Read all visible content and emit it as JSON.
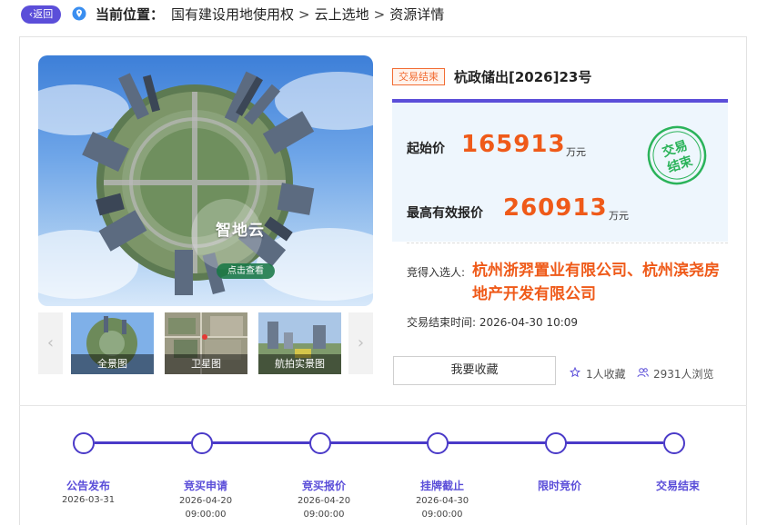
{
  "breadcrumb": {
    "back_label": "返回",
    "location_label": "当前位置：",
    "items": [
      "国有建设用地使用权",
      "云上选地",
      "资源详情"
    ],
    "separator": ">"
  },
  "gallery": {
    "hero_logo": "智地云",
    "hero_button": "点击查看",
    "thumbnails": [
      {
        "label": "全景图"
      },
      {
        "label": "卫星图"
      },
      {
        "label": "航拍实景图"
      }
    ],
    "prev_icon": "chevron-left-icon",
    "next_icon": "chevron-right-icon"
  },
  "lot": {
    "status_tag": "交易结束",
    "title": "杭政储出[2026]23号",
    "start_price_label": "起始价",
    "start_price": "165913",
    "start_price_unit": "万元",
    "max_bid_label": "最高有效报价",
    "max_bid": "260913",
    "max_bid_unit": "万元",
    "stamp_text_line1": "交易",
    "stamp_text_line2": "结束",
    "winner_label": "竞得入选人:",
    "winner_name": "杭州浙羿置业有限公司、杭州滨尧房地产开发有限公司",
    "end_time_label": "交易结束时间:",
    "end_time": "2026-04-30 10:09",
    "favorite_button": "我要收藏",
    "favorites_count": "1人收藏",
    "views_count": "2931人浏览"
  },
  "timeline": {
    "steps": [
      {
        "label": "公告发布",
        "date": "2026-03-31",
        "time": ""
      },
      {
        "label": "竞买申请",
        "date": "2026-04-20",
        "time": "09:00:00"
      },
      {
        "label": "竞买报价",
        "date": "2026-04-20",
        "time": "09:00:00"
      },
      {
        "label": "挂牌截止",
        "date": "2026-04-30",
        "time": "09:00:00"
      },
      {
        "label": "限时竞价",
        "date": "",
        "time": ""
      },
      {
        "label": "交易结束",
        "date": "",
        "time": ""
      }
    ]
  },
  "colors": {
    "accent": "#5b4ed9",
    "price": "#ef5a19",
    "stamp": "#2bb35a",
    "timeline": "#4a3ac8"
  }
}
